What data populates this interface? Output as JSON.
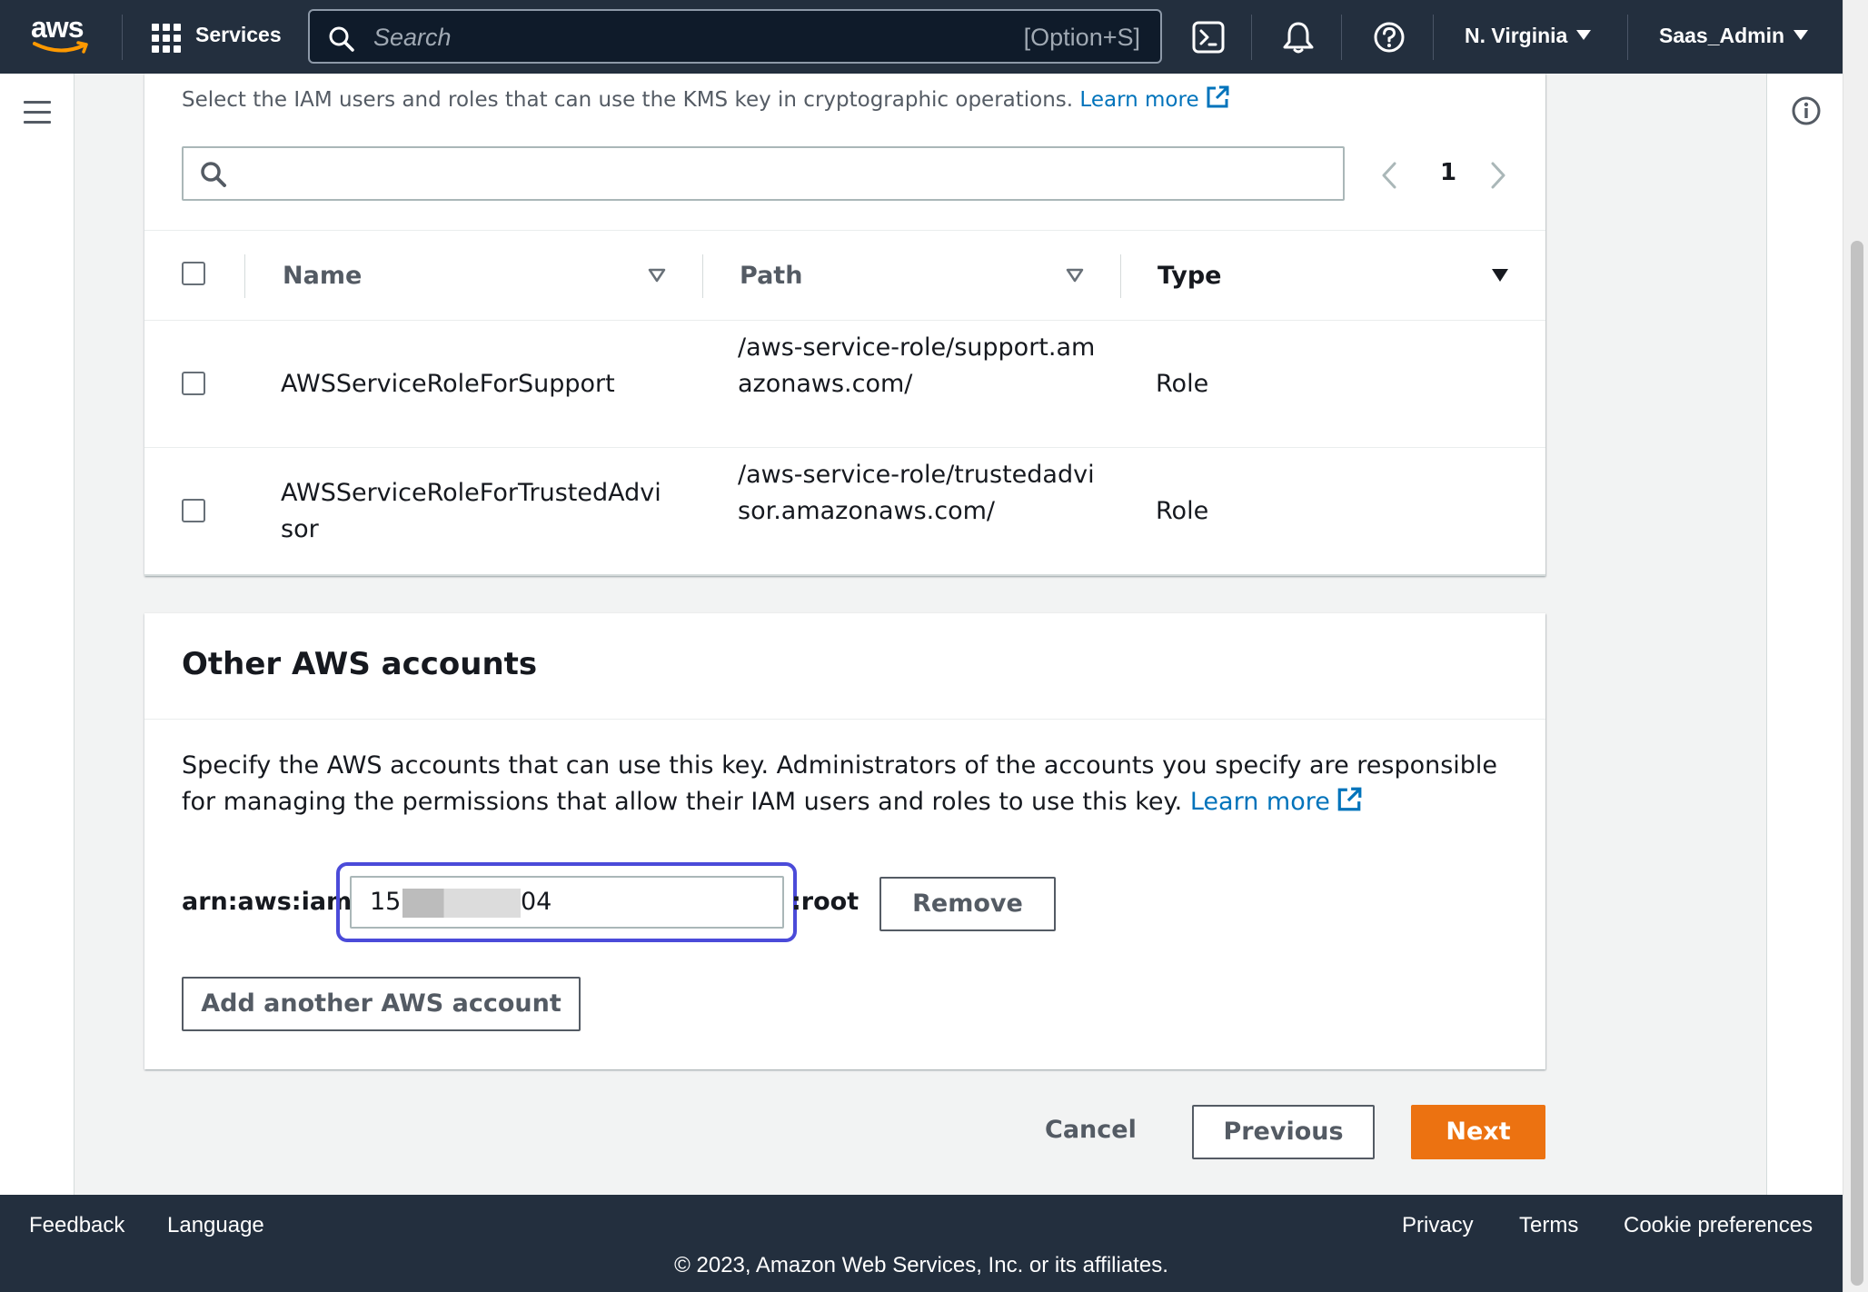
{
  "nav": {
    "logo": "aws",
    "services": "Services",
    "search_placeholder": "Search",
    "search_shortcut": "[Option+S]",
    "region": "N. Virginia",
    "user": "Saas_Admin"
  },
  "key_users": {
    "description": "Select the IAM users and roles that can use the KMS key in cryptographic operations.",
    "learn_more": "Learn more",
    "filter_placeholder": "",
    "page": "1",
    "columns": [
      "Name",
      "Path",
      "Type"
    ],
    "rows": [
      {
        "name": "AWSServiceRoleForSupport",
        "path": "/aws-service-role/support.amazonaws.com/",
        "type": "Role"
      },
      {
        "name": "AWSServiceRoleForTrustedAdvisor",
        "path": "/aws-service-role/trustedadvisor.amazonaws.com/",
        "type": "Role"
      }
    ]
  },
  "other_accounts": {
    "title": "Other AWS accounts",
    "description": "Specify the AWS accounts that can use this key. Administrators of the accounts you specify are responsible for managing the permissions that allow their IAM users and roles to use this key.",
    "learn_more": "Learn more",
    "arn_prefix": "arn:aws:iam::",
    "account_start": "15",
    "account_end": "04",
    "arn_suffix": ":root",
    "remove": "Remove",
    "add_another": "Add another AWS account"
  },
  "actions": {
    "cancel": "Cancel",
    "previous": "Previous",
    "next": "Next"
  },
  "footer": {
    "feedback": "Feedback",
    "language": "Language",
    "privacy": "Privacy",
    "terms": "Terms",
    "cookie": "Cookie preferences",
    "copyright": "© 2023, Amazon Web Services, Inc. or its affiliates."
  },
  "colors": {
    "nav_bg": "#232f3e",
    "link": "#0073bb",
    "primary_button": "#ec7211",
    "focus_ring": "#4b4bd9"
  }
}
